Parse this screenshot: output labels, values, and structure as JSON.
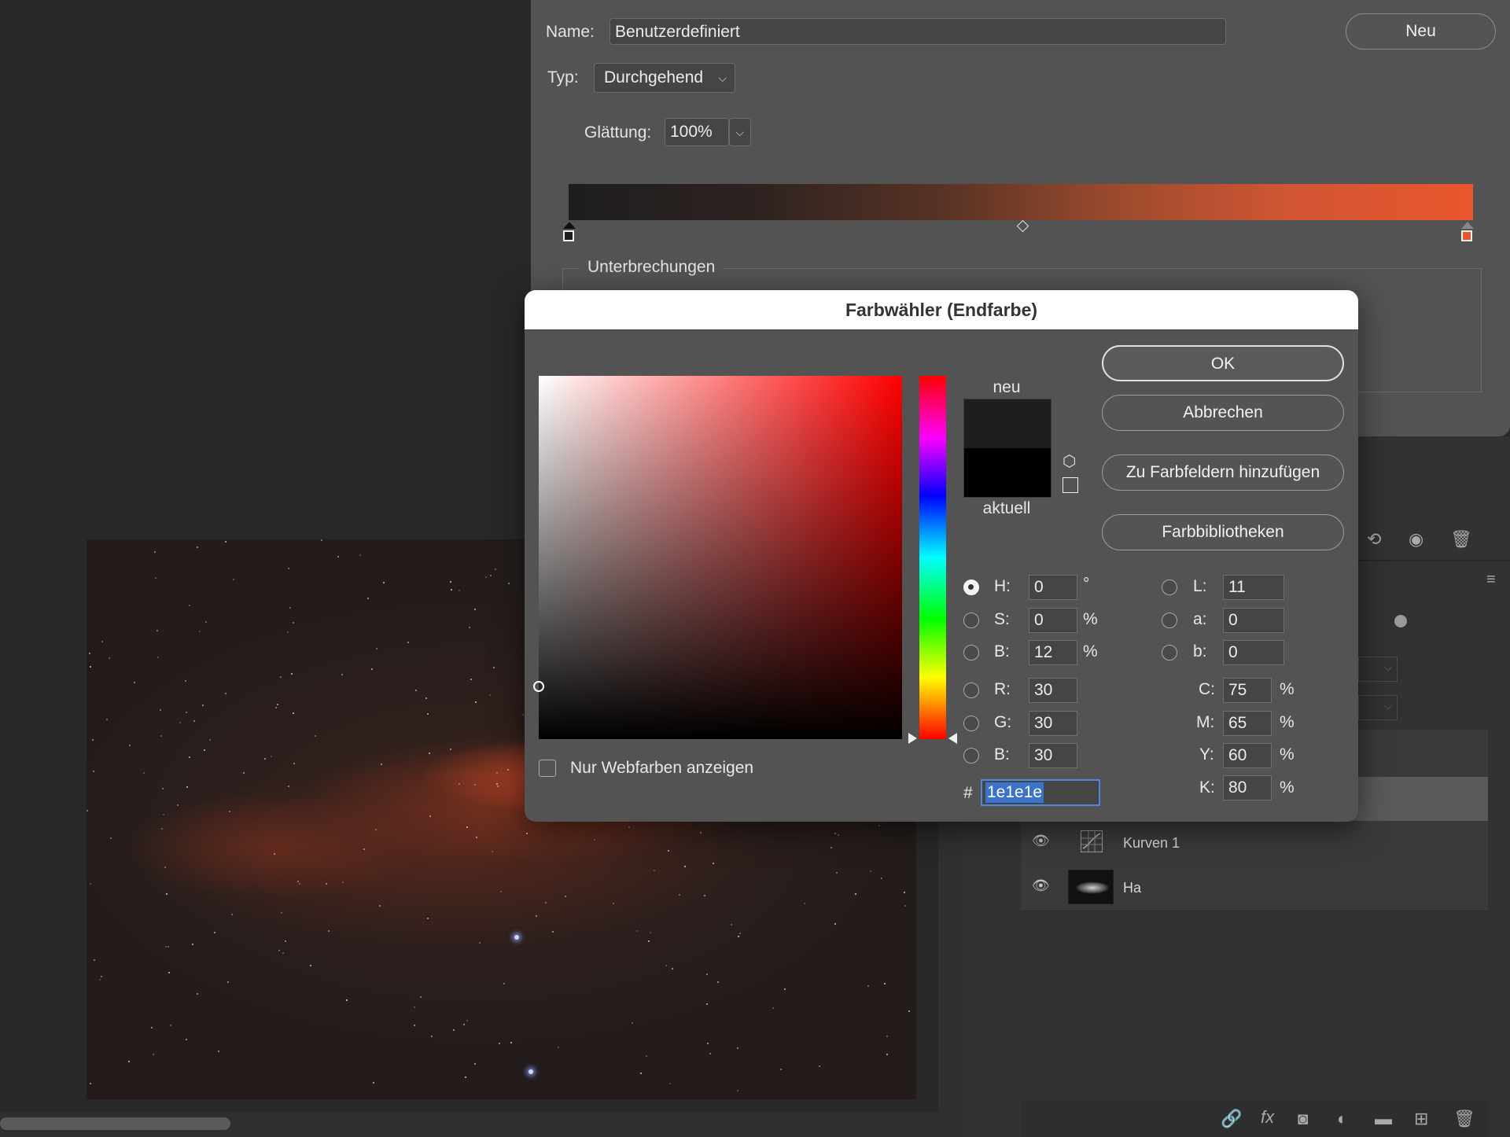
{
  "gradient_editor": {
    "name_label": "Name:",
    "name_value": "Benutzerdefiniert",
    "new_button": "Neu",
    "type_label": "Typ:",
    "type_value": "Durchgehend",
    "smoothness_label": "Glättung:",
    "smoothness_value": "100%",
    "stops_group_label": "Unterbrechungen",
    "start_color": "#1e1e1e",
    "end_color": "#e8562d"
  },
  "color_picker": {
    "title": "Farbwähler (Endfarbe)",
    "new_label": "neu",
    "current_label": "aktuell",
    "new_color": "#1e1e1e",
    "current_color": "#000000",
    "buttons": {
      "ok": "OK",
      "cancel": "Abbrechen",
      "add_to_swatches": "Zu Farbfeldern hinzufügen",
      "color_libraries": "Farbbibliotheken"
    },
    "hsb": {
      "h_label": "H:",
      "h_value": "0",
      "h_unit": "°",
      "s_label": "S:",
      "s_value": "0",
      "s_unit": "%",
      "b_label": "B:",
      "b_value": "12",
      "b_unit": "%"
    },
    "rgb": {
      "r_label": "R:",
      "r_value": "30",
      "g_label": "G:",
      "g_value": "30",
      "b_label": "B:",
      "b_value": "30"
    },
    "lab": {
      "l_label": "L:",
      "l_value": "11",
      "a_label": "a:",
      "a_value": "0",
      "b_label": "b:",
      "b_value": "0"
    },
    "cmyk": {
      "c_label": "C:",
      "c_value": "75",
      "m_label": "M:",
      "m_value": "65",
      "y_label": "Y:",
      "y_value": "60",
      "k_label": "K:",
      "k_value": "80",
      "unit": "%"
    },
    "hex_label": "#",
    "hex_value": "1e1e1e",
    "web_colors_label": "Nur Webfarben anzeigen"
  },
  "layers": [
    {
      "name": "Kurven 1",
      "icon": "curves-adjustment-icon"
    },
    {
      "name": "Ha",
      "icon": "image-thumbnail"
    }
  ],
  "icons": {
    "eye": "eye-icon",
    "reset": "reset-icon",
    "trash": "trash-icon",
    "panel_menu": "panel-menu-icon",
    "footer": [
      "link-icon",
      "fx-icon",
      "mask-icon",
      "adjustment-icon",
      "folder-icon",
      "new-layer-icon",
      "trash-icon"
    ]
  }
}
